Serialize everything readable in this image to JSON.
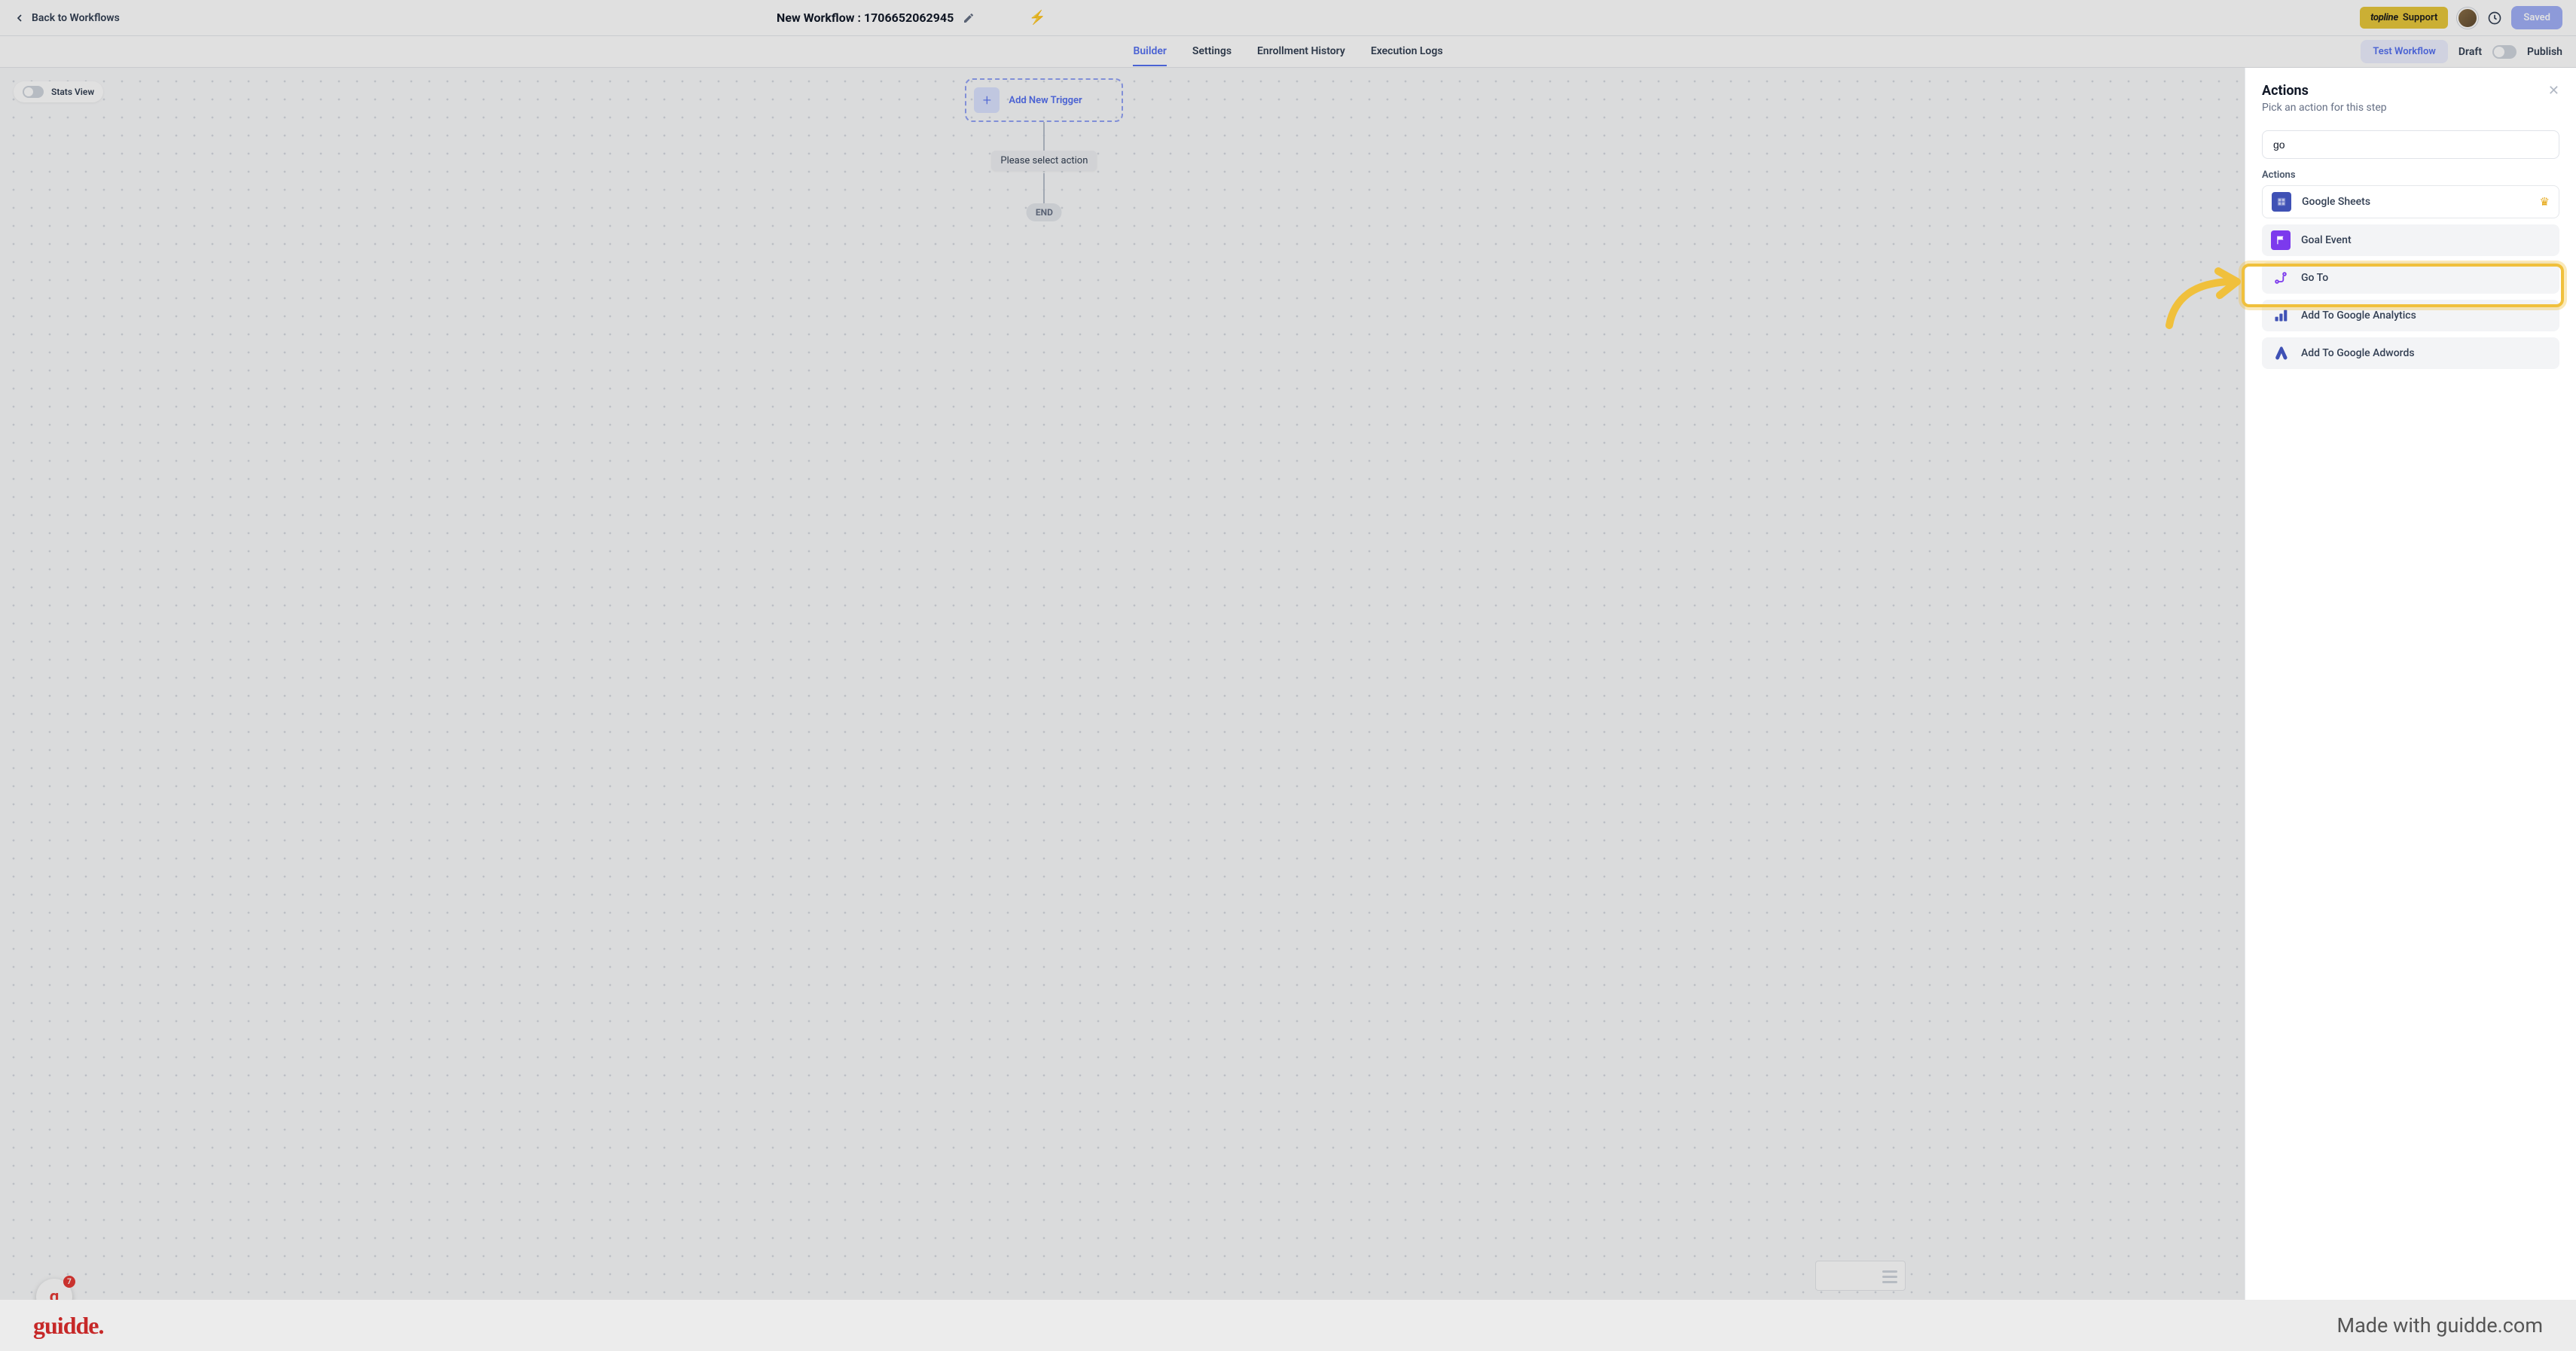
{
  "header": {
    "back_label": "Back to Workflows",
    "title_prefix": "New Workflow : ",
    "title_id": "1706652062945",
    "support_brand": "topline",
    "support_label": "Support",
    "saved_label": "Saved"
  },
  "tabs": {
    "items": [
      "Builder",
      "Settings",
      "Enrollment History",
      "Execution Logs"
    ],
    "active_index": 0,
    "test_label": "Test Workflow",
    "draft_label": "Draft",
    "publish_label": "Publish"
  },
  "canvas": {
    "stats_label": "Stats View",
    "add_trigger": "Add New Trigger",
    "select_action": "Please select action",
    "end_label": "END",
    "g_badge_count": "7"
  },
  "sidebar": {
    "title": "Actions",
    "subtitle": "Pick an action for this step",
    "search_value": "go",
    "actions_header": "Actions",
    "items": [
      {
        "label": "Google Sheets",
        "icon": "sheets",
        "premium": true
      },
      {
        "label": "Goal Event",
        "icon": "goal",
        "premium": false
      },
      {
        "label": "Go To",
        "icon": "goto",
        "premium": false
      },
      {
        "label": "Add To Google Analytics",
        "icon": "analytics",
        "premium": false
      },
      {
        "label": "Add To Google Adwords",
        "icon": "adwords",
        "premium": false
      }
    ]
  },
  "footer": {
    "logo": "guidde",
    "made_with": "Made with guidde.com"
  }
}
